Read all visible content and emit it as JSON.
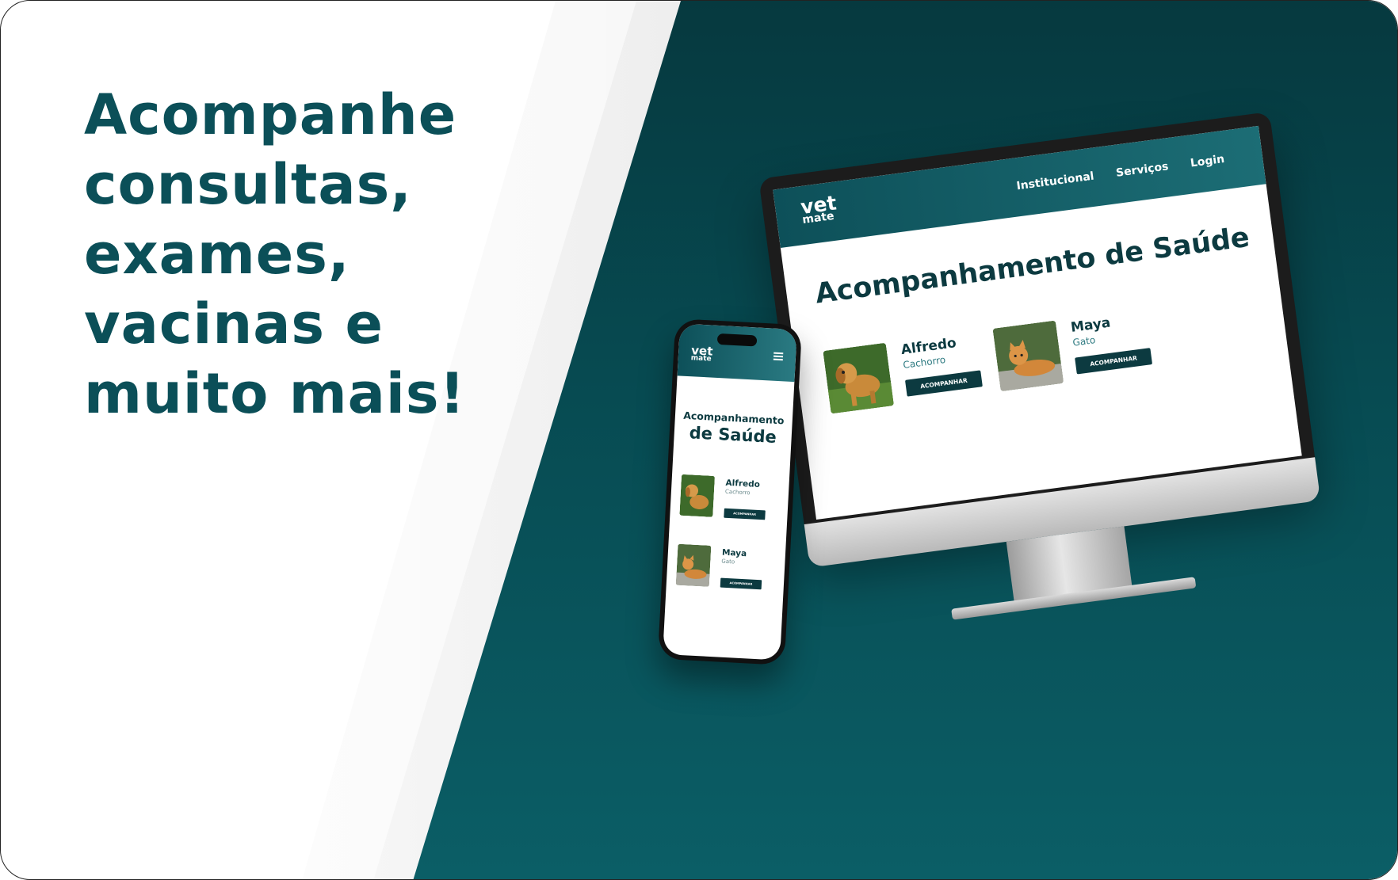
{
  "hero": {
    "headline_lines": [
      "Acompanhe",
      "consultas,",
      "exames,",
      "vacinas e",
      "muito mais!"
    ]
  },
  "desktop": {
    "logo": {
      "line1": "vet",
      "line2": "mate"
    },
    "nav": [
      {
        "label": "Institucional"
      },
      {
        "label": "Serviços"
      },
      {
        "label": "Login"
      }
    ],
    "title": "Acompanhamento de Saúde",
    "pets": [
      {
        "name": "Alfredo",
        "type": "Cachorro",
        "button": "ACOMPANHAR",
        "photo_icon": "dog-photo"
      },
      {
        "name": "Maya",
        "type": "Gato",
        "button": "ACOMPANHAR",
        "photo_icon": "cat-photo"
      }
    ]
  },
  "mobile": {
    "logo": {
      "line1": "vet",
      "line2": "mate"
    },
    "menu_icon": "hamburger-icon",
    "title_line1": "Acompanhamento",
    "title_line2": "de Saúde",
    "pets": [
      {
        "name": "Alfredo",
        "type": "Cachorro",
        "button": "ACOMPANHAR"
      },
      {
        "name": "Maya",
        "type": "Gato",
        "button": "ACOMPANHAR"
      }
    ]
  },
  "colors": {
    "brand_teal": "#0b4f58",
    "dark_teal": "#0c3a40",
    "background_teal": "#074b52"
  }
}
